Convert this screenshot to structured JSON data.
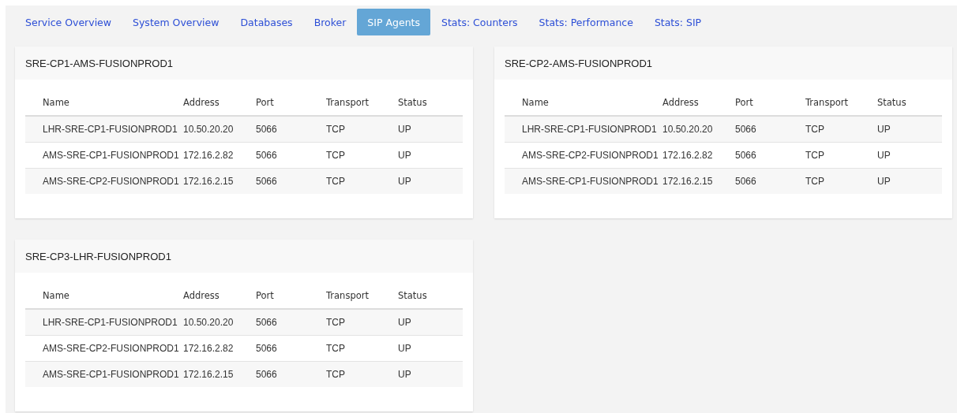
{
  "tabs": [
    {
      "label": "Service Overview",
      "selected": false
    },
    {
      "label": "System Overview",
      "selected": false
    },
    {
      "label": "Databases",
      "selected": false
    },
    {
      "label": "Broker",
      "selected": false
    },
    {
      "label": "SIP Agents",
      "selected": true
    },
    {
      "label": "Stats: Counters",
      "selected": false
    },
    {
      "label": "Stats: Performance",
      "selected": false
    },
    {
      "label": "Stats: SIP",
      "selected": false
    }
  ],
  "cards": [
    {
      "title": "SRE-CP1-AMS-FUSIONPROD1",
      "columns": [
        "Name",
        "Address",
        "Port",
        "Transport",
        "Status"
      ],
      "rows": [
        [
          "LHR-SRE-CP1-FUSIONPROD1",
          "10.50.20.20",
          "5066",
          "TCP",
          "UP"
        ],
        [
          "AMS-SRE-CP1-FUSIONPROD1",
          "172.16.2.82",
          "5066",
          "TCP",
          "UP"
        ],
        [
          "AMS-SRE-CP2-FUSIONPROD1",
          "172.16.2.15",
          "5066",
          "TCP",
          "UP"
        ]
      ]
    },
    {
      "title": "SRE-CP2-AMS-FUSIONPROD1",
      "columns": [
        "Name",
        "Address",
        "Port",
        "Transport",
        "Status"
      ],
      "rows": [
        [
          "LHR-SRE-CP1-FUSIONPROD1",
          "10.50.20.20",
          "5066",
          "TCP",
          "UP"
        ],
        [
          "AMS-SRE-CP2-FUSIONPROD1",
          "172.16.2.82",
          "5066",
          "TCP",
          "UP"
        ],
        [
          "AMS-SRE-CP1-FUSIONPROD1",
          "172.16.2.15",
          "5066",
          "TCP",
          "UP"
        ]
      ]
    },
    {
      "title": "SRE-CP3-LHR-FUSIONPROD1",
      "columns": [
        "Name",
        "Address",
        "Port",
        "Transport",
        "Status"
      ],
      "rows": [
        [
          "LHR-SRE-CP1-FUSIONPROD1",
          "10.50.20.20",
          "5066",
          "TCP",
          "UP"
        ],
        [
          "AMS-SRE-CP2-FUSIONPROD1",
          "172.16.2.82",
          "5066",
          "TCP",
          "UP"
        ],
        [
          "AMS-SRE-CP1-FUSIONPROD1",
          "172.16.2.15",
          "5066",
          "TCP",
          "UP"
        ]
      ]
    }
  ]
}
